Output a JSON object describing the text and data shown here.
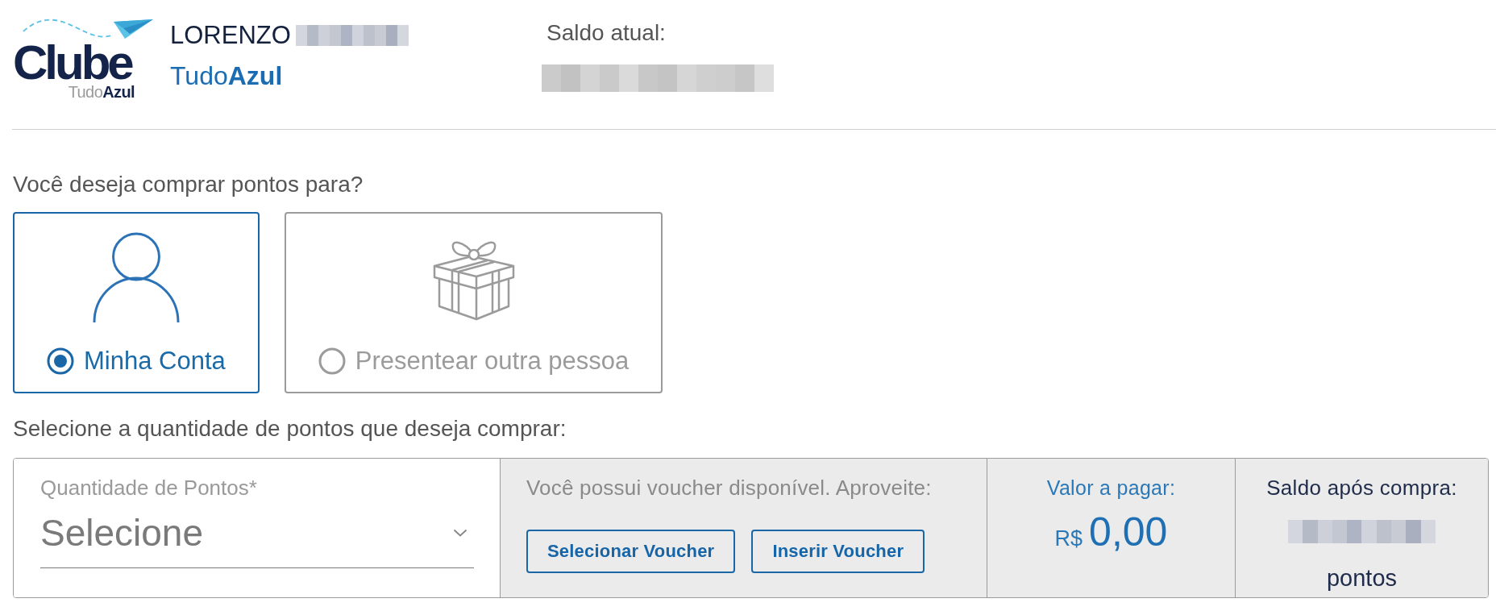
{
  "header": {
    "logo": {
      "title": "Clube",
      "subtitle": "Tudo**Azul**"
    },
    "user": {
      "name": "LORENZO",
      "surname_redacted": true,
      "program": "Tudo**Azul**"
    },
    "balance": {
      "label": "Saldo atual:",
      "value_redacted": true
    }
  },
  "recipient": {
    "question": "Você deseja comprar pontos para?",
    "options": [
      {
        "kind": "self",
        "label": "Minha Conta",
        "selected": true
      },
      {
        "kind": "gift",
        "label": "Presentear outra pessoa",
        "selected": false
      }
    ]
  },
  "purchase": {
    "prompt": "Selecione a quantidade de pontos que deseja comprar:",
    "quantity": {
      "label": "Quantidade de Pontos*",
      "placeholder": "Selecione"
    },
    "voucher": {
      "message": "Você possui voucher disponível. Aproveite:",
      "buttons": [
        "Selecionar Voucher",
        "Inserir Voucher"
      ]
    },
    "amount": {
      "label": "Valor a pagar:",
      "currency": "R$",
      "value": "0,00"
    },
    "balance_after": {
      "label": "Saldo após compra:",
      "value_redacted": true,
      "unit": "pontos"
    }
  }
}
